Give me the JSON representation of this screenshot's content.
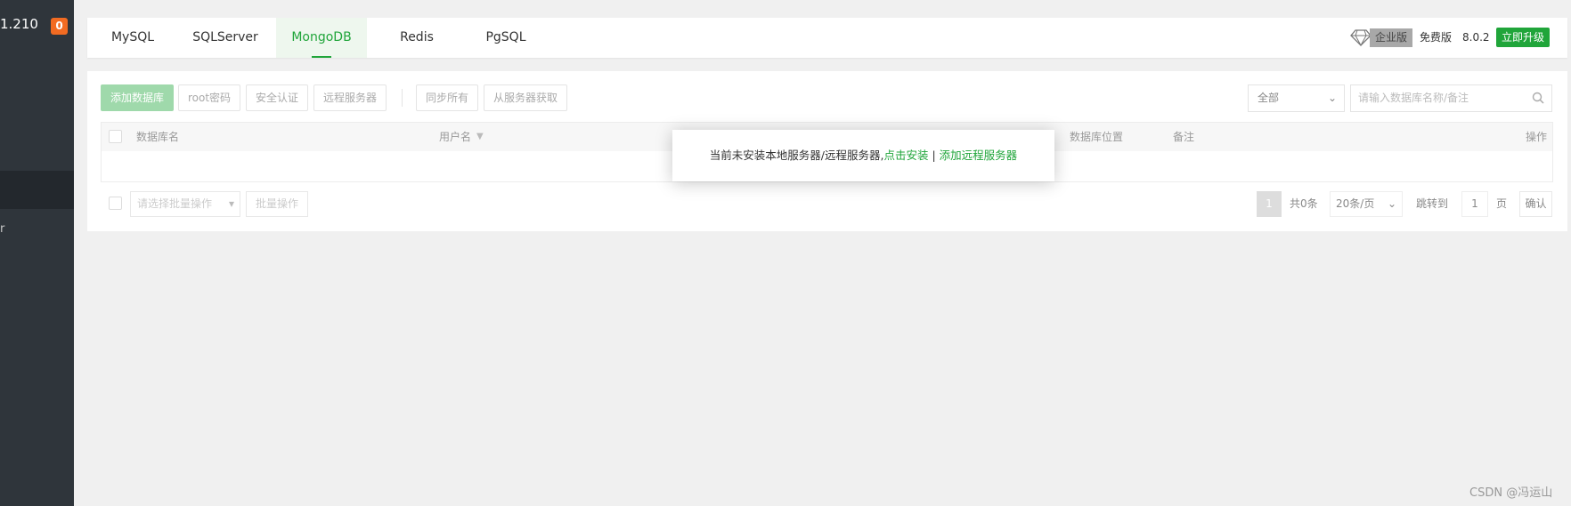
{
  "sidebar": {
    "host_fragment": "1.210",
    "badge_count": "0",
    "item_fragment": "r"
  },
  "tabs": [
    {
      "label": "MySQL"
    },
    {
      "label": "SQLServer"
    },
    {
      "label": "MongoDB",
      "active": true
    },
    {
      "label": "Redis"
    },
    {
      "label": "PgSQL"
    }
  ],
  "header_right": {
    "enterprise_label": "企业版",
    "free_label": "免费版",
    "version": "8.0.2",
    "upgrade_label": "立即升级"
  },
  "toolbar": {
    "add_db": "添加数据库",
    "root_password": "root密码",
    "security_auth": "安全认证",
    "remote_server": "远程服务器",
    "sync_all": "同步所有",
    "fetch_from_server": "从服务器获取"
  },
  "filter": {
    "selected": "全部",
    "search_placeholder": "请输入数据库名称/备注"
  },
  "table": {
    "columns": [
      "数据库名",
      "用户名",
      "数据库位置",
      "备注",
      "操作"
    ]
  },
  "batch": {
    "placeholder": "请选择批量操作",
    "button": "批量操作"
  },
  "pagination": {
    "current_page": "1",
    "total": "共0条",
    "page_size": "20条/页",
    "jump_label": "跳转到",
    "jump_value": "1",
    "page_unit": "页",
    "confirm": "确认"
  },
  "popup": {
    "message": "当前未安装本地服务器/远程服务器,",
    "install_link": "点击安装",
    "separator": " | ",
    "add_remote_link": "添加远程服务器"
  },
  "watermark": "CSDN @冯运山",
  "colors": {
    "accent": "#20a53a",
    "sidebar_bg": "#2f353b",
    "badge": "#f26b22"
  }
}
